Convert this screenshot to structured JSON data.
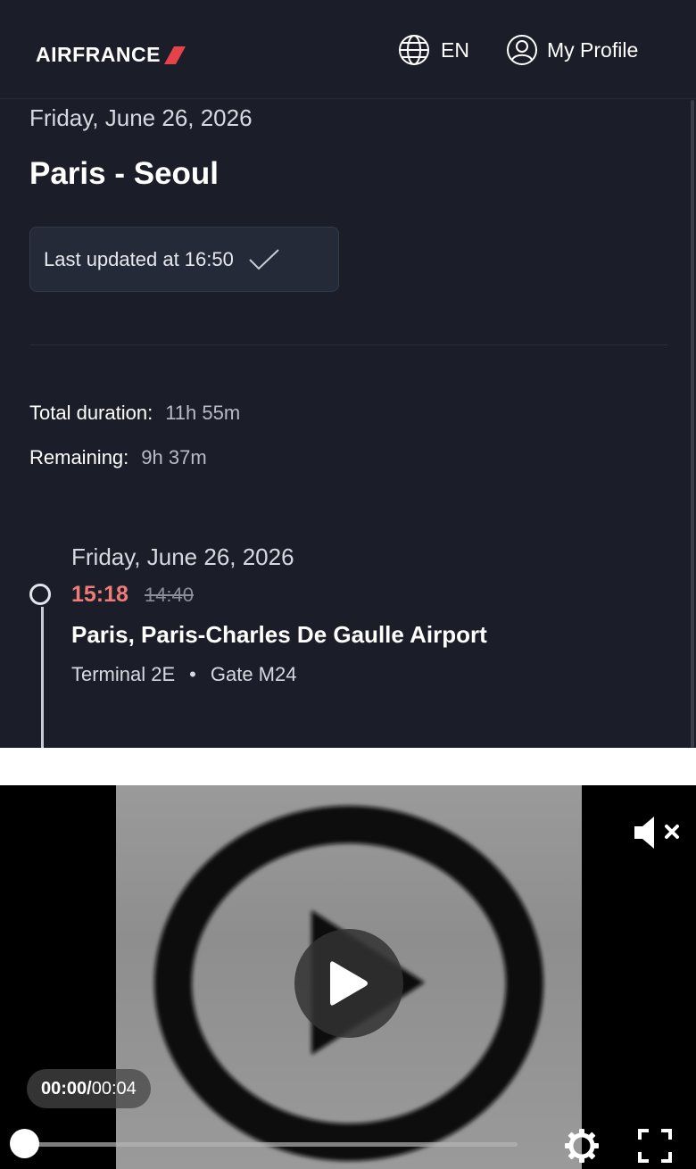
{
  "header": {
    "logo": "AIRFRANCE",
    "language": "EN",
    "profile": "My Profile"
  },
  "flight": {
    "date": "Friday, June 26, 2026",
    "route": "Paris - Seoul",
    "last_updated": "Last updated at 16:50"
  },
  "stats": {
    "total_label": "Total duration:",
    "total_value": "11h 55m",
    "remaining_label": "Remaining:",
    "remaining_value": "9h 37m"
  },
  "departure": {
    "date": "Friday, June 26, 2026",
    "new_time": "15:18",
    "old_time": "14:40",
    "airport": "Paris, Paris-Charles De Gaulle Airport",
    "terminal": "Terminal 2E",
    "separator": "•",
    "gate": "Gate M24"
  },
  "video": {
    "current_time": "00:00",
    "separator": "/",
    "duration": " 00:04",
    "progress": 0,
    "muted": true
  },
  "colors": {
    "background": "#1b1e29",
    "accent_red": "#f07b78",
    "logo_slash": "#e4434b"
  },
  "icons": [
    "globe-icon",
    "user-circle-icon",
    "check-icon",
    "play-icon",
    "mute-icon",
    "settings-icon",
    "fullscreen-icon"
  ]
}
